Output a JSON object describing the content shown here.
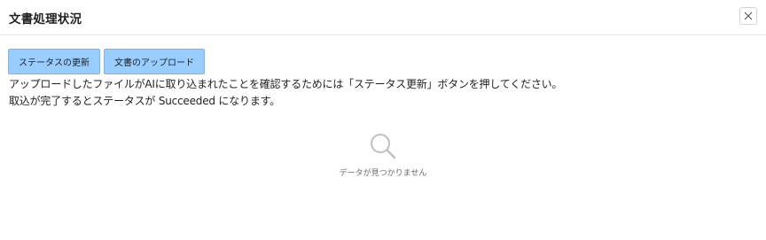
{
  "dialog": {
    "title": "文書処理状況",
    "close_icon": "close-icon"
  },
  "toolbar": {
    "update_status_label": "ステータスの更新",
    "upload_label": "文書のアップロード"
  },
  "instructions": {
    "line1": "アップロードしたファイルがAIに取り込まれたことを確認するためには「ステータス更新」ボタンを押してください。",
    "line2": "取込が完了するとステータスが Succeeded になります。"
  },
  "empty_state": {
    "icon": "search-icon",
    "text": "データが見つかりません"
  },
  "colors": {
    "button_bg": "#99ccff",
    "empty_text": "#6b6b6b"
  }
}
